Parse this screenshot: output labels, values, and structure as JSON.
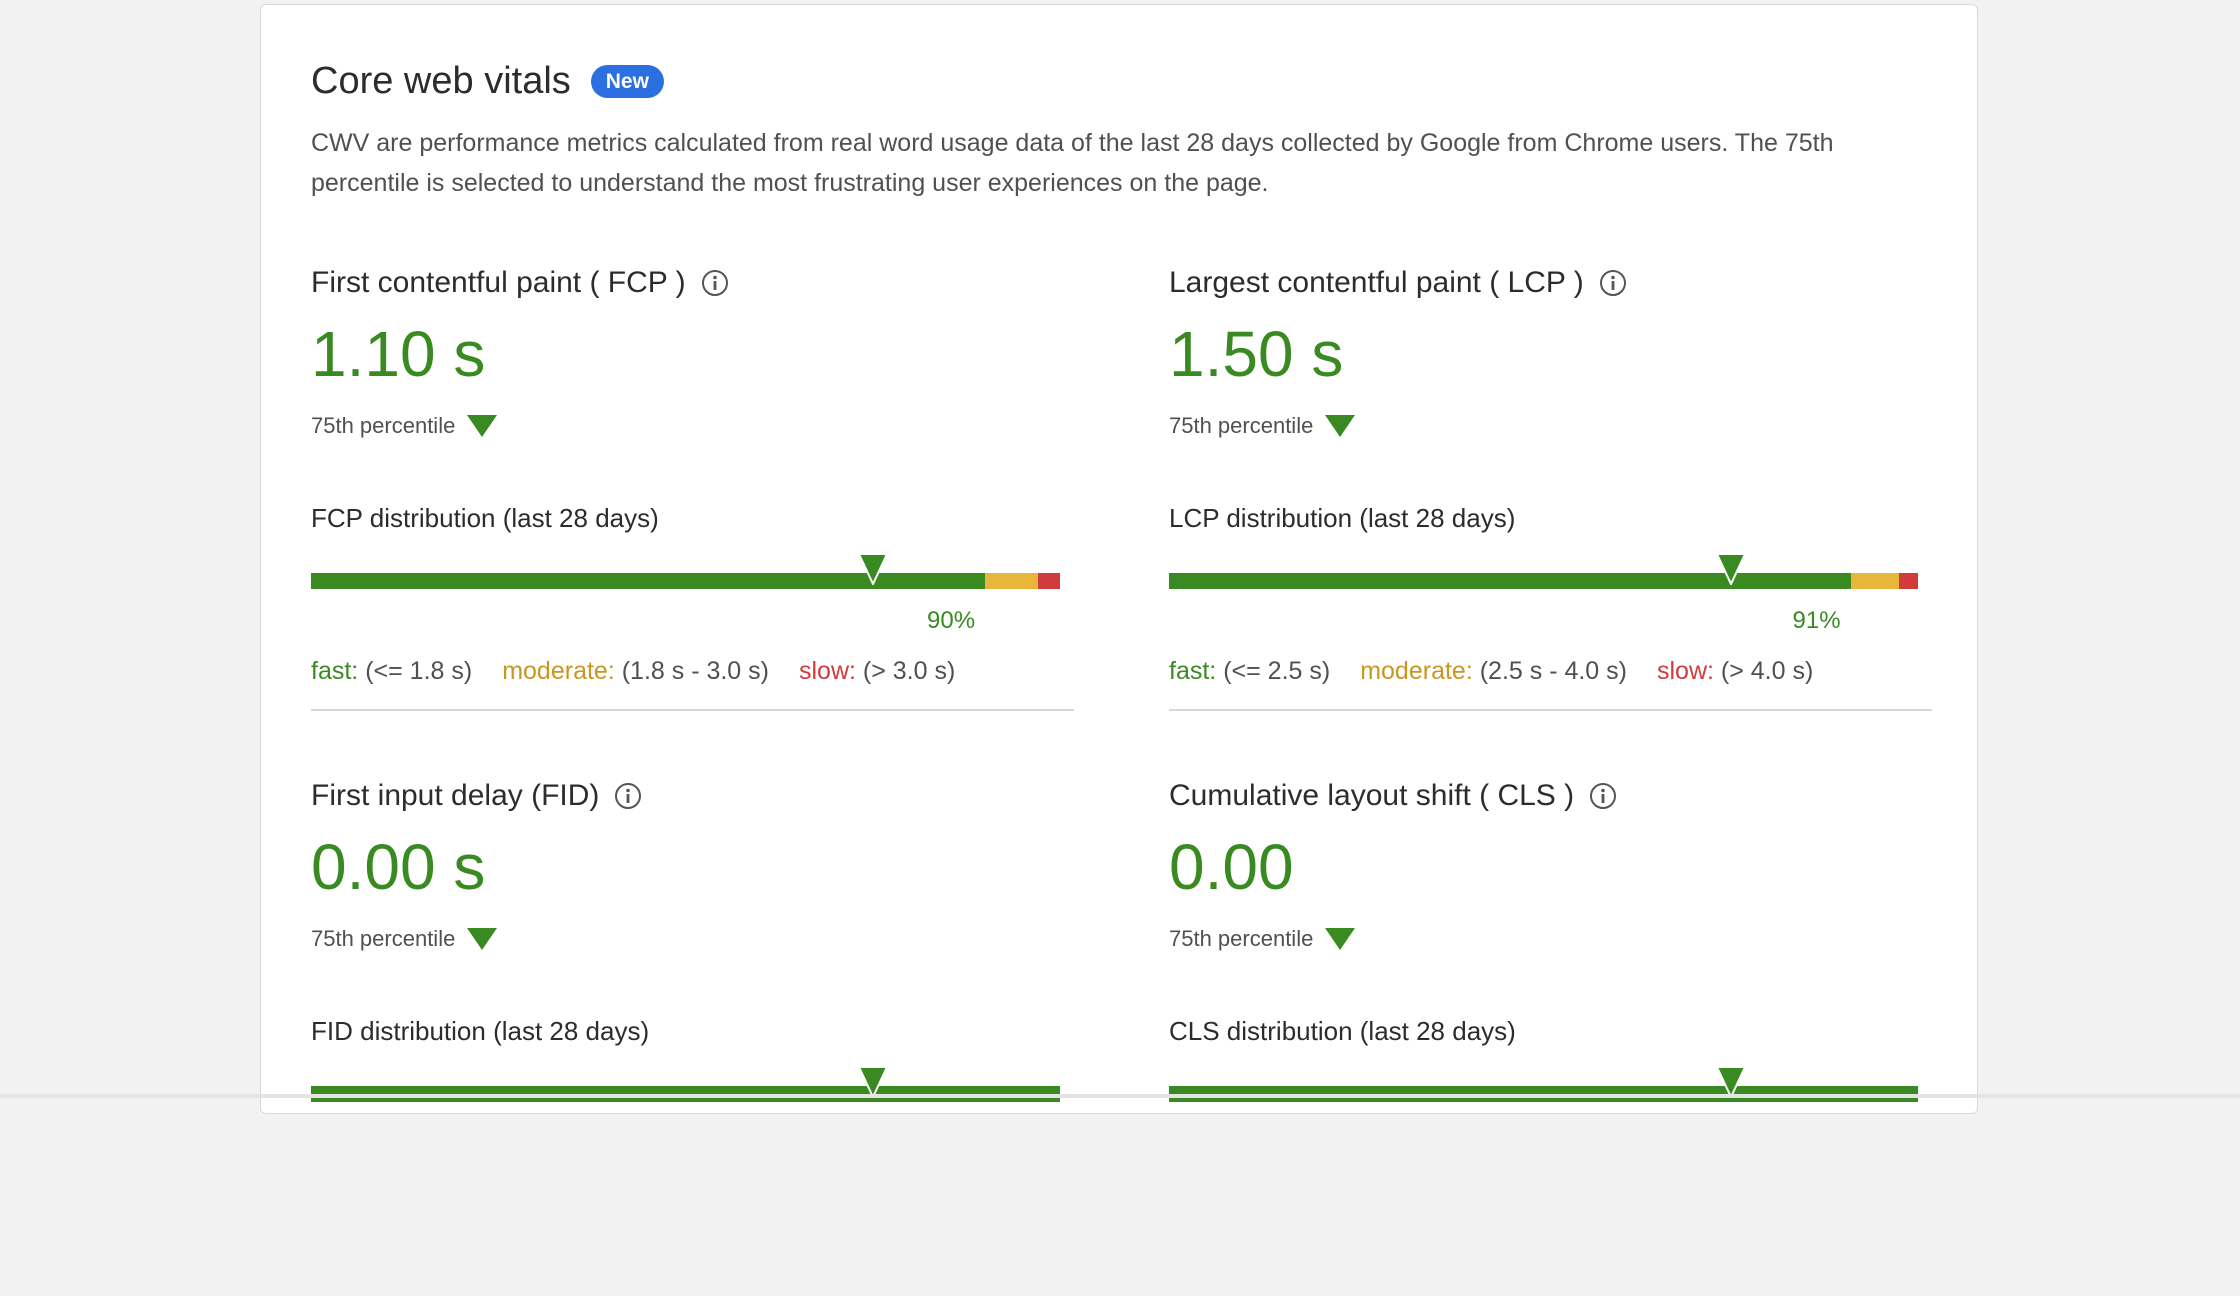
{
  "header": {
    "title": "Core web vitals",
    "badge": "New",
    "description": "CWV are performance metrics calculated from real word usage data of the last 28 days collected by Google from Chrome users. The 75th percentile is selected to understand the most frustrating user experiences on the page."
  },
  "colors": {
    "fast": "#3a8a22",
    "moderate": "#e8b63a",
    "slow": "#d23b3b",
    "badge": "#2b6fe0"
  },
  "metrics": [
    {
      "title": "First contentful paint ( FCP )",
      "value": "1.10 s",
      "percentile_label": "75th percentile",
      "distribution_label": "FCP distribution (last 28 days)",
      "fast_share": 0.9,
      "moderate_share": 0.07,
      "slow_share": 0.03,
      "fast_pct_label": "90%",
      "marker_position": 0.75,
      "legend": {
        "fast_label": "fast:",
        "fast_range": "(<= 1.8 s)",
        "moderate_label": "moderate:",
        "moderate_range": "(1.8 s - 3.0 s)",
        "slow_label": "slow:",
        "slow_range": "(> 3.0 s)"
      }
    },
    {
      "title": "Largest contentful paint ( LCP )",
      "value": "1.50 s",
      "percentile_label": "75th percentile",
      "distribution_label": "LCP distribution (last 28 days)",
      "fast_share": 0.91,
      "moderate_share": 0.065,
      "slow_share": 0.025,
      "fast_pct_label": "91%",
      "marker_position": 0.75,
      "legend": {
        "fast_label": "fast:",
        "fast_range": "(<= 2.5 s)",
        "moderate_label": "moderate:",
        "moderate_range": "(2.5 s - 4.0 s)",
        "slow_label": "slow:",
        "slow_range": "(> 4.0 s)"
      }
    },
    {
      "title": "First input delay (FID)",
      "value": "0.00 s",
      "percentile_label": "75th percentile",
      "distribution_label": "FID distribution (last 28 days)",
      "fast_share": 1.0,
      "moderate_share": 0,
      "slow_share": 0,
      "marker_position": 0.75
    },
    {
      "title": "Cumulative layout shift ( CLS )",
      "value": "0.00",
      "percentile_label": "75th percentile",
      "distribution_label": "CLS distribution (last 28 days)",
      "fast_share": 1.0,
      "moderate_share": 0,
      "slow_share": 0,
      "marker_position": 0.75
    }
  ]
}
